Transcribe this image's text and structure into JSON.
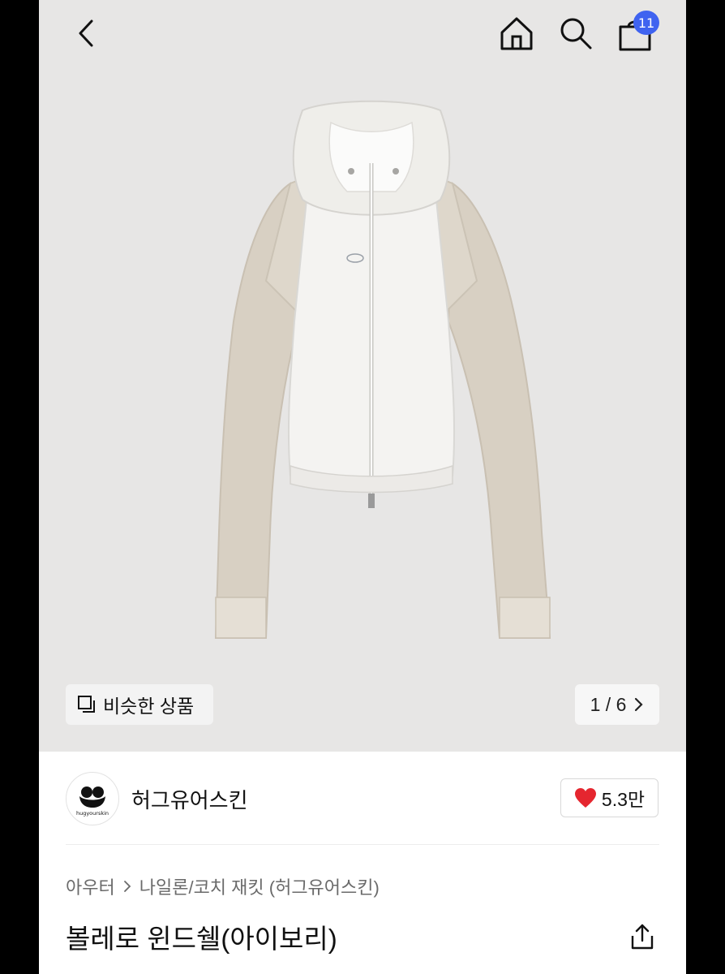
{
  "header": {
    "back_icon": "chevron-left-icon",
    "home_icon": "home-icon",
    "search_icon": "search-icon",
    "cart_icon": "cart-icon",
    "cart_count": "11"
  },
  "gallery": {
    "similar_label": "비슷한 상품",
    "similar_icon": "similar-items-icon",
    "pager_text": "1 / 6",
    "pager_icon": "chevron-right-icon"
  },
  "brand": {
    "name": "허그유어스킨",
    "logo_text": "hugyourskin",
    "like_count": "5.3만",
    "like_icon": "heart-icon",
    "heart_color": "#e5262f"
  },
  "product": {
    "breadcrumb": [
      "아우터",
      "나일론/코치 재킷 (허그유어스킨)"
    ],
    "title": "볼레로 윈드쉘(아이보리)",
    "share_icon": "share-icon"
  },
  "colors": {
    "badge": "#3f63f0",
    "hero_bg": "#e7e6e5"
  }
}
